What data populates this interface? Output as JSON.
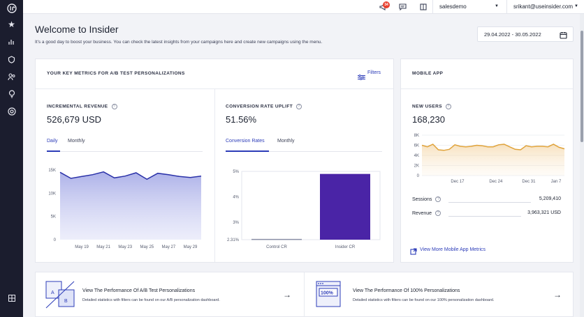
{
  "topbar": {
    "notification_count": "34",
    "account": "salesdemo",
    "user": "srikant@useinsider.com"
  },
  "header": {
    "title": "Welcome to Insider",
    "subtitle": "It's a good day to boost your business. You can check the latest insights from your campaigns here and create new campaigns using the menu.",
    "date_range": "29.04.2022 - 30.05.2022"
  },
  "ab_card": {
    "heading": "YOUR KEY METRICS FOR A/B TEST PERSONALIZATIONS",
    "filters_label": "Filters",
    "revenue": {
      "label": "INCREMENTAL REVENUE",
      "value": "526,679 USD",
      "tabs": [
        "Daily",
        "Monthly"
      ]
    },
    "conversion": {
      "label": "CONVERSION RATE UPLIFT",
      "value": "51.56%",
      "tabs": [
        "Conversion Rates",
        "Monthly"
      ]
    }
  },
  "mobile_card": {
    "heading": "MOBILE APP",
    "new_users": {
      "label": "NEW USERS",
      "value": "168,230"
    },
    "sessions_label": "Sessions",
    "sessions_value": "5,209,410",
    "revenue_label": "Revenue",
    "revenue_value": "3,963,321 USD",
    "link": "View More Mobile App Metrics"
  },
  "bottom": [
    {
      "title": "View The Performance Of A/B Test Personalizations",
      "desc": "Detailed statistics with filters can be found on our A/B personalization dashboard."
    },
    {
      "title": "View The Performance Of 100% Personalizations",
      "desc": "Detailed statistics with filters can be found on our 100% personalization dashboard.",
      "icon_text": "100%"
    }
  ],
  "colors": {
    "accent": "#2c3cb8",
    "bar_purple": "#4a24a6",
    "mobile_line": "#e0a33a",
    "nav": "#1b1d2e"
  },
  "chart_data": [
    {
      "type": "area",
      "categories": [
        "May 19",
        "May 21",
        "May 23",
        "May 25",
        "May 27",
        "May 29"
      ],
      "x": [
        17,
        18,
        19,
        20,
        21,
        22,
        23,
        24,
        25,
        26,
        27,
        28,
        29,
        30
      ],
      "values": [
        14500,
        13200,
        13600,
        14000,
        14600,
        13300,
        13700,
        14400,
        13000,
        14300,
        14000,
        13600,
        13400,
        13700
      ],
      "yticks": [
        "15K",
        "10K",
        "5K",
        "0"
      ],
      "ylim": [
        0,
        15000
      ]
    },
    {
      "type": "bar",
      "categories": [
        "Control CR",
        "Insider CR"
      ],
      "values": [
        2.34,
        4.9
      ],
      "yticks": [
        "5%",
        "4%",
        "3%",
        "2.31%"
      ],
      "ylim": [
        2.31,
        5
      ]
    },
    {
      "type": "line",
      "categories": [
        "Dec 17",
        "Dec 24",
        "Dec 31",
        "Jan 7"
      ],
      "values": [
        6000,
        5700,
        6200,
        5100,
        5000,
        5200,
        6100,
        5800,
        5700,
        5800,
        6000,
        5900,
        5700,
        5700,
        6100,
        6200,
        5700,
        5200,
        5100,
        5900,
        5700,
        5800,
        5800,
        5700,
        6200,
        5600,
        5300
      ],
      "yticks": [
        "8K",
        "6K",
        "4K",
        "2K",
        "0"
      ],
      "ylim": [
        0,
        8000
      ]
    }
  ]
}
